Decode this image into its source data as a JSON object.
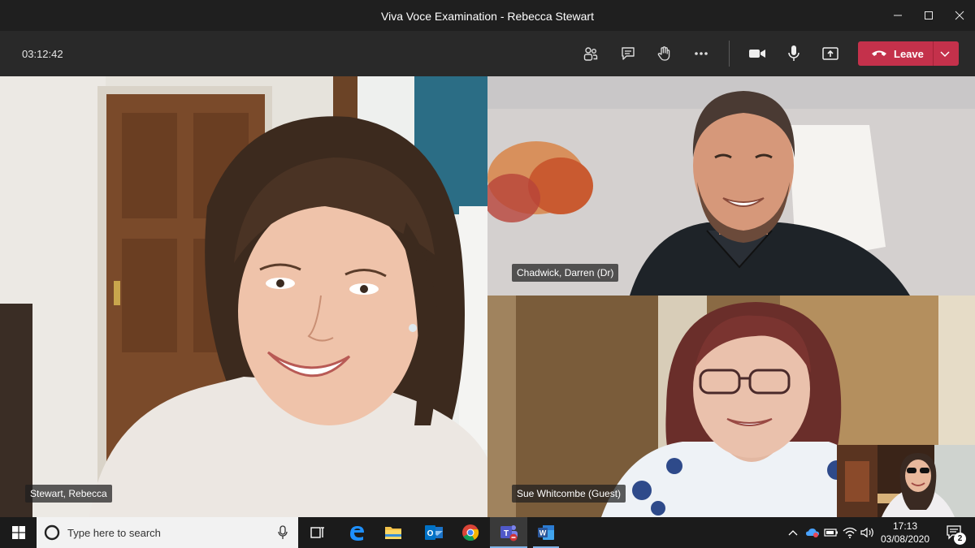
{
  "window": {
    "title": "Viva Voce Examination - Rebecca Stewart"
  },
  "meeting": {
    "timer": "03:12:42",
    "toolbar_icons": [
      "participants-icon",
      "chat-icon",
      "raise-hand-icon",
      "more-options-icon",
      "camera-icon",
      "microphone-icon",
      "share-screen-icon"
    ],
    "leave_label": "Leave"
  },
  "participants": {
    "main": "Stewart, Rebecca",
    "top_right": "Chadwick, Darren (Dr)",
    "bottom_right": "Sue Whitcombe (Guest)"
  },
  "taskbar": {
    "search_placeholder": "Type here to search",
    "time": "17:13",
    "date": "03/08/2020",
    "notification_count": "2",
    "colors": {
      "accent": "#c4314b",
      "teams": "#5059c9",
      "word": "#2b579a",
      "outlook": "#0072c6"
    }
  }
}
